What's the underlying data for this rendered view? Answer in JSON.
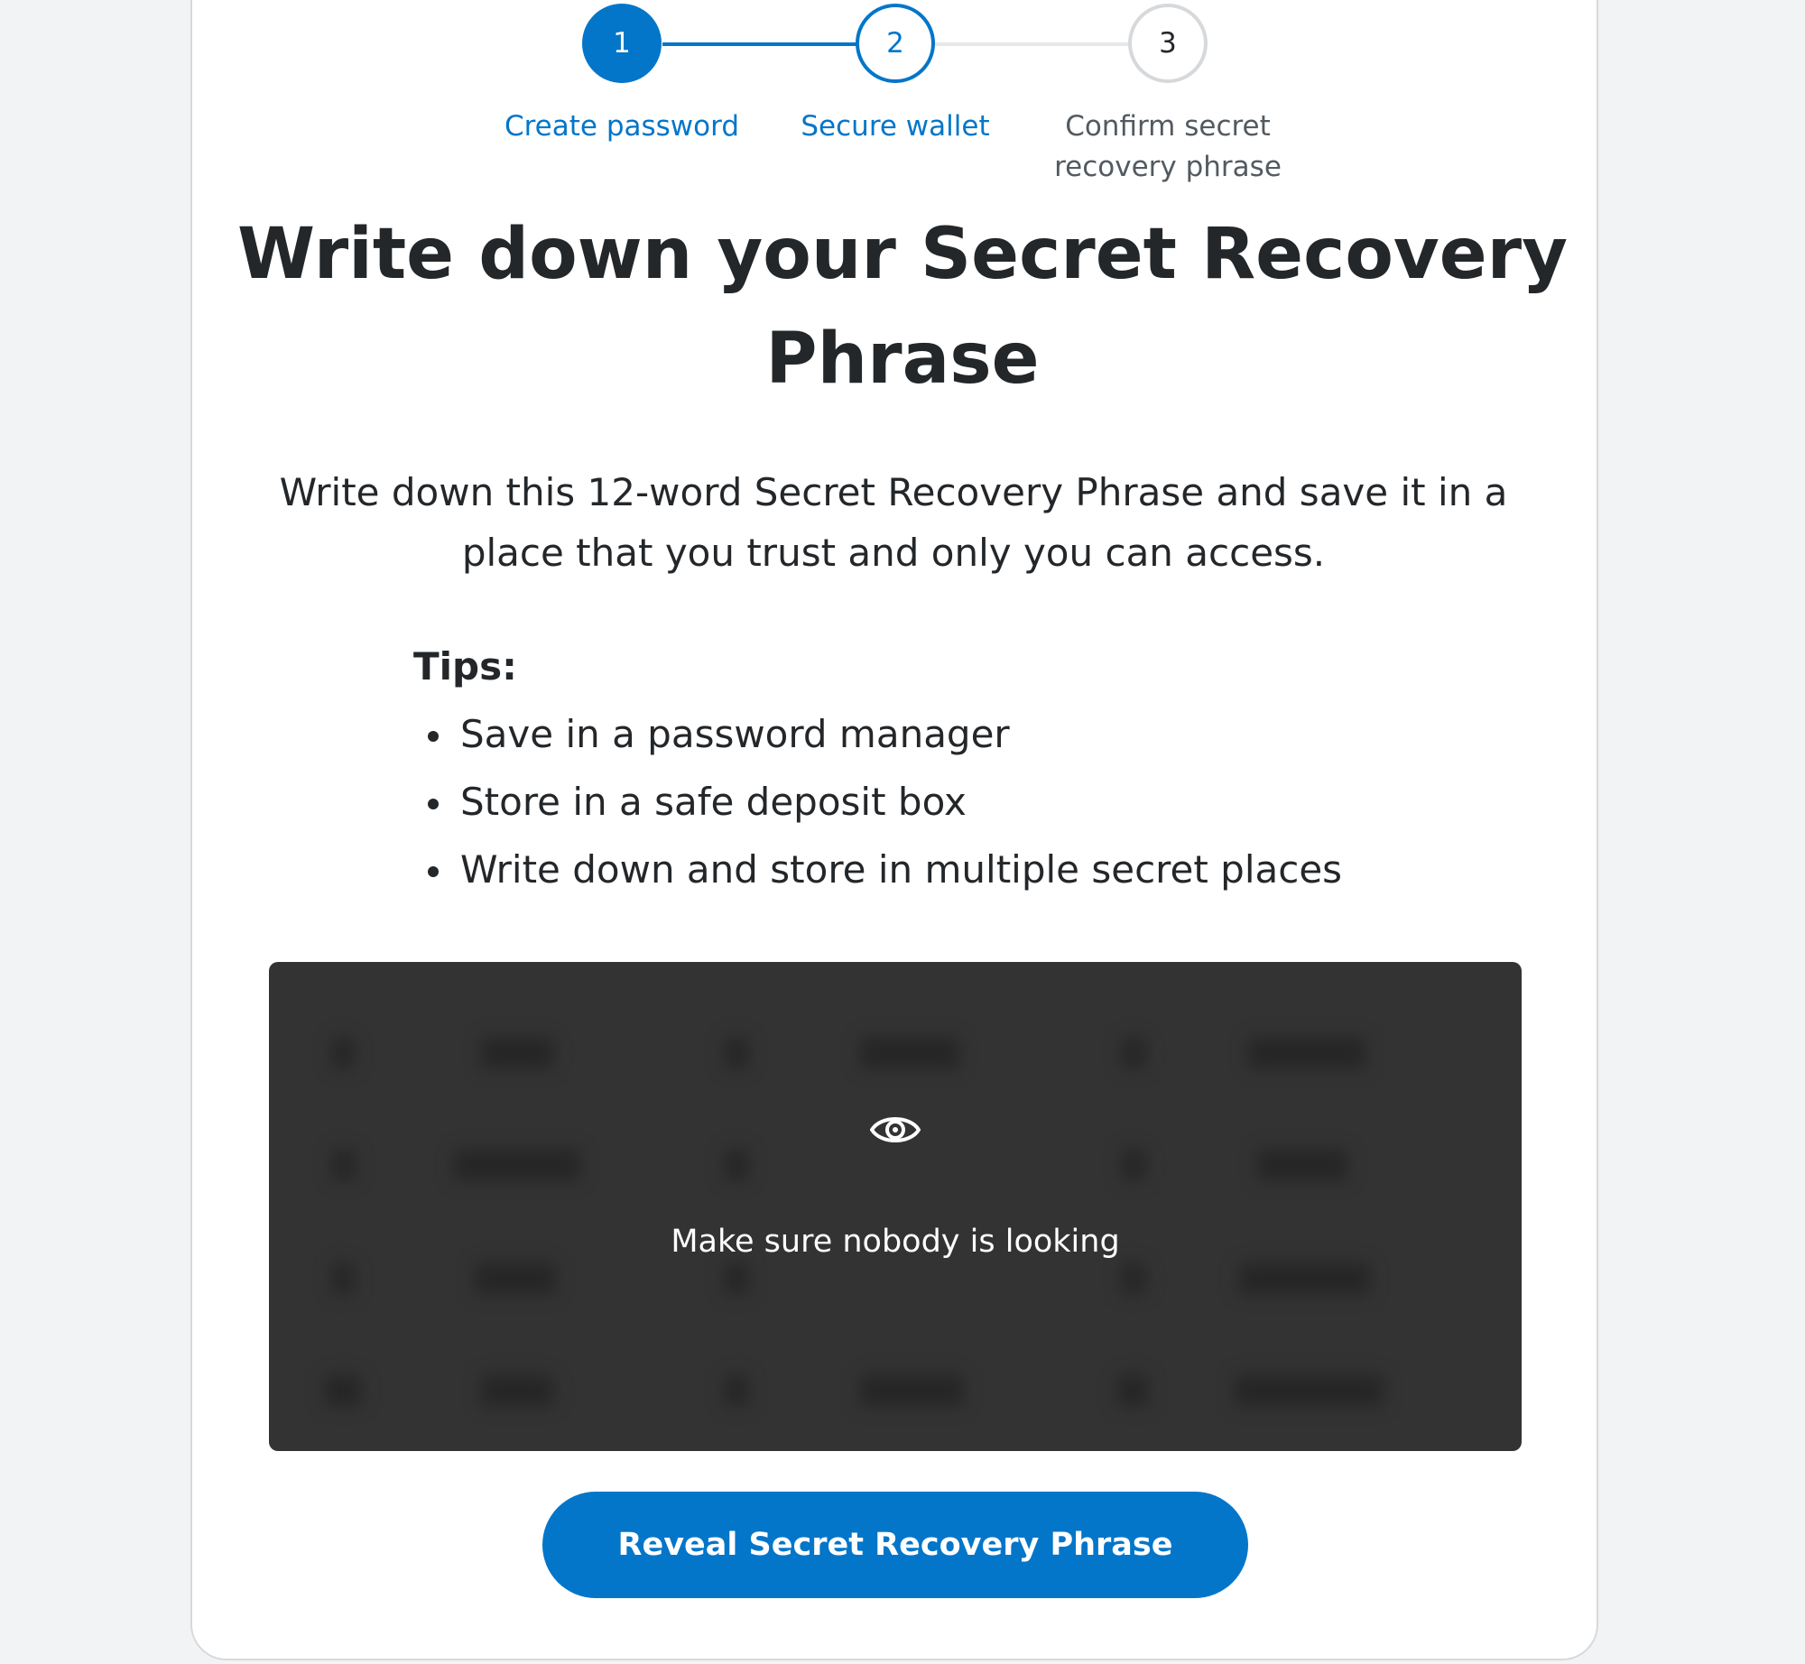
{
  "stepper": {
    "steps": [
      {
        "number": "1",
        "label": "Create password"
      },
      {
        "number": "2",
        "label": "Secure wallet"
      },
      {
        "number": "3",
        "label": "Confirm secret recovery phrase"
      }
    ]
  },
  "title": "Write down your Secret Recovery Phrase",
  "description": "Write down this 12-word Secret Recovery Phrase and save it in a place that you trust and only you can access.",
  "tips": {
    "title": "Tips:",
    "items": [
      "Save in a password manager",
      "Store in a safe deposit box",
      "Write down and store in multiple secret places"
    ]
  },
  "phrase_box": {
    "icon": "eye-icon",
    "message": "Make sure nobody is looking"
  },
  "reveal_button": {
    "label": "Reveal Secret Recovery Phrase"
  },
  "colors": {
    "accent": "#0376c9",
    "phrase_box_bg": "#333333",
    "text": "#24272a"
  }
}
